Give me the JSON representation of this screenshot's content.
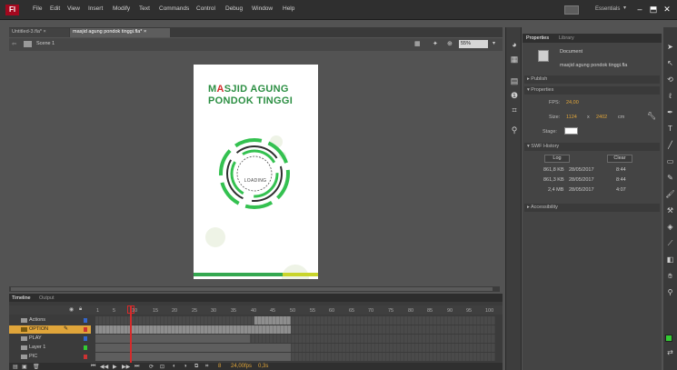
{
  "app": {
    "logo": "Fl",
    "menu": [
      "File",
      "Edit",
      "View",
      "Insert",
      "Modify",
      "Text",
      "Commands",
      "Control",
      "Debug",
      "Window",
      "Help"
    ],
    "workspace": "Essentials",
    "window_controls": [
      "–",
      "⬒",
      "✕"
    ]
  },
  "tabs": [
    {
      "label": "Untitled-3.fla* ×"
    },
    {
      "label": "masjid agung pondok tinggi.fla* ×"
    }
  ],
  "editbar": {
    "scene": "Scene 1",
    "zoom": "55%"
  },
  "stage": {
    "title_line1_pre": "M",
    "title_line1_accent": "A",
    "title_line1_post": "SJID AGUNG",
    "title_line2": "PONDOK TINGGI",
    "loading": "LOADING",
    "colors": {
      "title": "#2c8f43",
      "accent": "#d52b2b",
      "ring": "#34c150",
      "footer_left": "#34a850",
      "footer_right": "#c8d52b"
    }
  },
  "properties": {
    "tabs": [
      "Properties",
      "Library"
    ],
    "doc_type": "Document",
    "doc_name": "masjid agung pondok tinggi.fla",
    "sections": {
      "publish": "▸ Publish",
      "properties": "▾ Properties",
      "swf_history": "▾ SWF History",
      "accessibility": "▸ Accessibility"
    },
    "fps_label": "FPS:",
    "fps": "24,00",
    "size_label": "Size:",
    "width": "1124",
    "times": "x",
    "height": "2402",
    "unit": "cm",
    "stage_label": "Stage:",
    "log_button": "Log",
    "clear_button": "Clear",
    "history": [
      {
        "size": "861,8 KB",
        "date": "28/05/2017",
        "time": "8:44"
      },
      {
        "size": "861,3 KB",
        "date": "28/05/2017",
        "time": "8:44"
      },
      {
        "size": "2,4 MB",
        "date": "28/05/2017",
        "time": "4:07"
      }
    ]
  },
  "timeline": {
    "tabs": [
      "Timeline",
      "Output"
    ],
    "frame_numbers": [
      "1",
      "5",
      "10",
      "15",
      "20",
      "25",
      "30",
      "35",
      "40",
      "45",
      "50",
      "55",
      "60",
      "65",
      "70",
      "75",
      "80",
      "85",
      "90",
      "95",
      "100"
    ],
    "layers": [
      {
        "name": "Actions",
        "selected": false,
        "color": "#3366cc"
      },
      {
        "name": "OPTION",
        "selected": true,
        "color": "#e0a53a"
      },
      {
        "name": "PLAY",
        "selected": false,
        "color": "#3366cc"
      },
      {
        "name": "Layer 1",
        "selected": false,
        "color": "#33cc33"
      },
      {
        "name": "PIC",
        "selected": false,
        "color": "#cc3333"
      }
    ],
    "fps_readout": "24,00fps",
    "time_readout": "0,3s",
    "frame_readout": "8"
  }
}
